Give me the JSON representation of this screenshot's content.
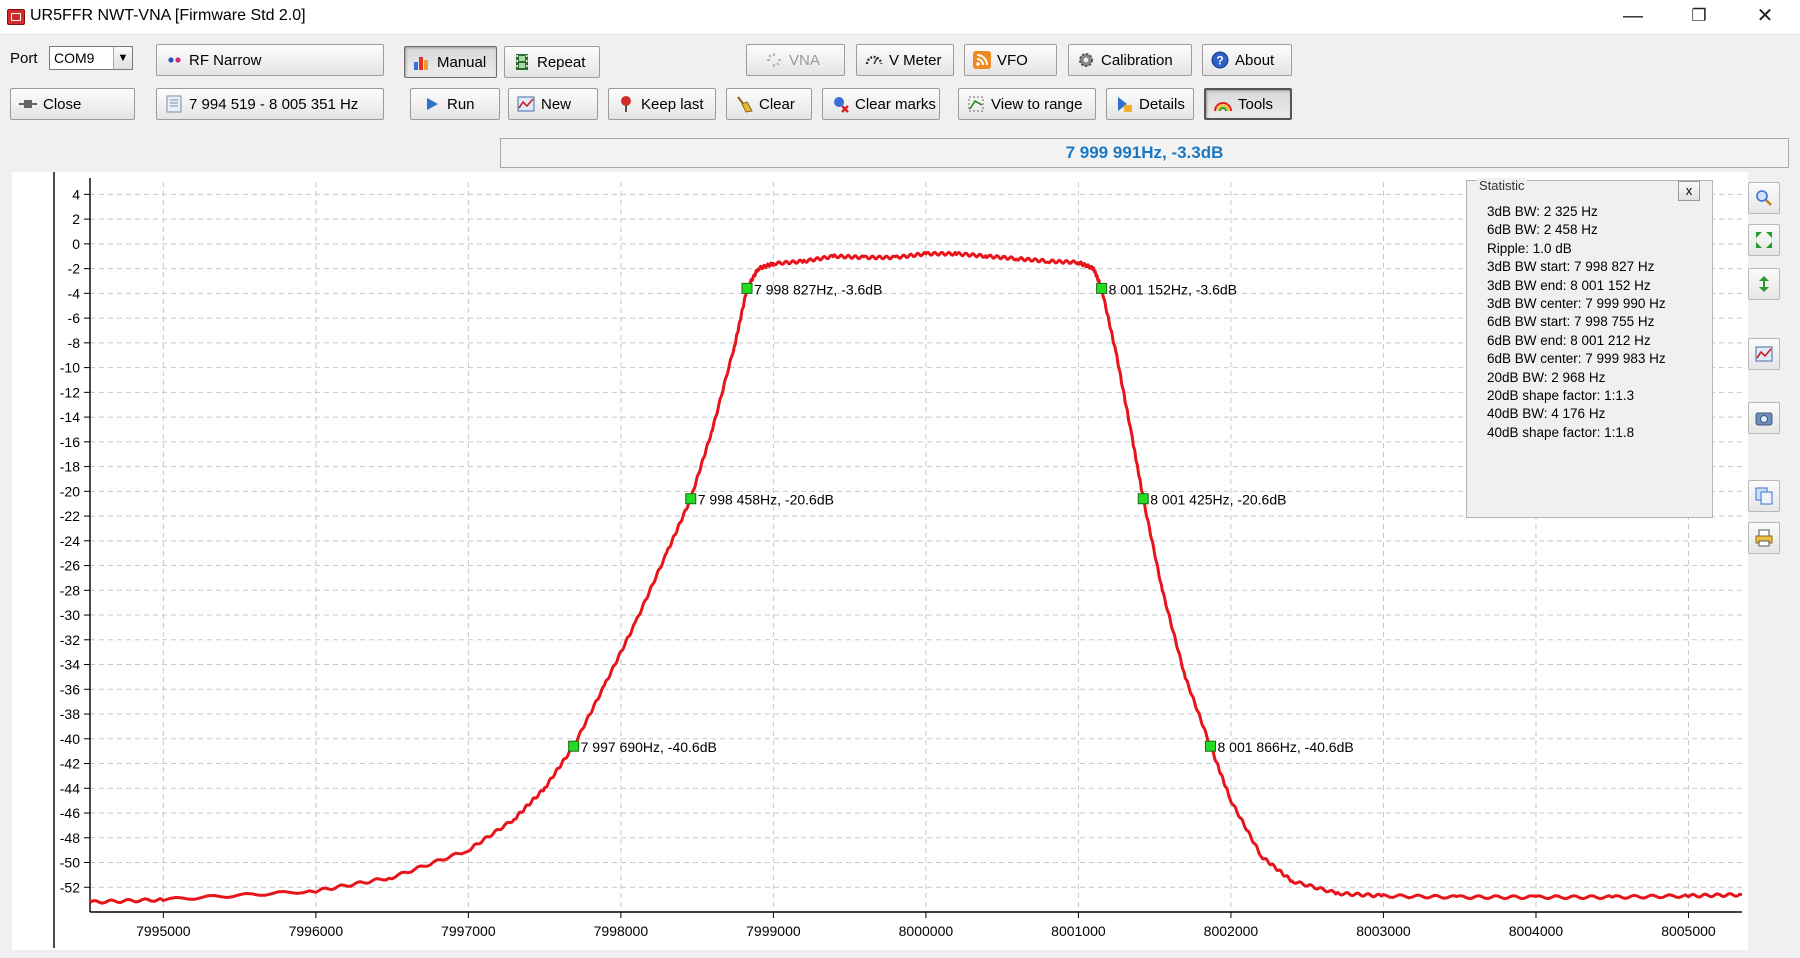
{
  "window": {
    "title": "UR5FFR NWT-VNA [Firmware Std 2.0]",
    "minimize": "—",
    "restore": "❐",
    "close": "✕"
  },
  "toolbar": {
    "port_label": "Port",
    "port_value": "COM9",
    "port_arrow": "▼",
    "rf_narrow": "RF Narrow",
    "close": "Close",
    "freq_range": "7 994 519 - 8 005 351 Hz",
    "manual": "Manual",
    "repeat": "Repeat",
    "run": "Run",
    "new": "New",
    "keep_last": "Keep last",
    "clear": "Clear",
    "clear_marks": "Clear marks",
    "view_to_range": "View to range",
    "details": "Details",
    "tools": "Tools",
    "vna": "VNA",
    "v_meter": "V Meter",
    "vfo": "VFO",
    "calibration": "Calibration",
    "about": "About"
  },
  "cursor_readout": "7 999 991Hz, -3.3dB",
  "statistic": {
    "title": "Statistic",
    "close": "x",
    "lines": [
      "3dB BW: 2 325 Hz",
      "6dB BW: 2 458 Hz",
      "Ripple: 1.0 dB",
      "3dB BW start: 7 998 827 Hz",
      "3dB BW end: 8 001 152 Hz",
      "3dB BW center: 7 999 990 Hz",
      "6dB BW start: 7 998 755 Hz",
      "6dB BW end: 8 001 212 Hz",
      "6dB BW center: 7 999 983 Hz",
      "20dB BW: 2 968 Hz",
      "20dB shape factor: 1:1.3",
      "40dB BW: 4 176 Hz",
      "40dB shape factor: 1:1.8"
    ]
  },
  "side_tools": [
    "zoom-icon",
    "fit-icon",
    "vertical-scale-icon",
    "chart-icon",
    "camera-icon",
    "copy-icon",
    "print-icon"
  ],
  "chart_data": {
    "type": "line",
    "title": "",
    "xlabel": "",
    "ylabel": "",
    "xlim": [
      7994519,
      8005351
    ],
    "ylim": [
      -54,
      5
    ],
    "grid": true,
    "x_ticks": [
      7995000,
      7996000,
      7997000,
      7998000,
      7999000,
      8000000,
      8001000,
      8002000,
      8003000,
      8004000,
      8005000
    ],
    "y_ticks": [
      4,
      2,
      0,
      -2,
      -4,
      -6,
      -8,
      -10,
      -12,
      -14,
      -16,
      -18,
      -20,
      -22,
      -24,
      -26,
      -28,
      -30,
      -32,
      -34,
      -36,
      -38,
      -40,
      -42,
      -44,
      -46,
      -48,
      -50,
      -52
    ],
    "series": [
      {
        "color": "#e8141c",
        "x": [
          7994519,
          7995000,
          7996000,
          7996500,
          7997000,
          7997300,
          7997500,
          7997690,
          7997900,
          7998100,
          7998300,
          7998458,
          7998600,
          7998750,
          7998827,
          7998900,
          7999000,
          7999200,
          7999400,
          7999600,
          7999800,
          8000000,
          8000200,
          8000400,
          8000600,
          8000800,
          8001000,
          8001100,
          8001152,
          8001250,
          8001350,
          8001425,
          8001550,
          8001700,
          8001866,
          8002000,
          8002200,
          8002400,
          8002700,
          8003000,
          8003500,
          8004000,
          8004500,
          8005000,
          8005351
        ],
        "y": [
          -53.2,
          -53.0,
          -52.3,
          -51.2,
          -49.0,
          -46.5,
          -44.0,
          -40.6,
          -35.5,
          -30.5,
          -25.0,
          -20.6,
          -15.0,
          -8.0,
          -3.6,
          -2.0,
          -1.6,
          -1.4,
          -1.0,
          -1.1,
          -1.1,
          -0.8,
          -0.8,
          -1.0,
          -1.2,
          -1.4,
          -1.5,
          -2.0,
          -3.6,
          -9.0,
          -15.5,
          -20.6,
          -28.0,
          -35.0,
          -40.6,
          -45.0,
          -49.5,
          -51.5,
          -52.5,
          -52.7,
          -52.8,
          -52.8,
          -52.8,
          -52.7,
          -52.6
        ]
      }
    ],
    "markers": [
      {
        "x": 7998827,
        "y": -3.6,
        "label": "7 998 827Hz, -3.6dB"
      },
      {
        "x": 8001152,
        "y": -3.6,
        "label": "8 001 152Hz, -3.6dB"
      },
      {
        "x": 7998458,
        "y": -20.6,
        "label": "7 998 458Hz, -20.6dB"
      },
      {
        "x": 8001425,
        "y": -20.6,
        "label": "8 001 425Hz, -20.6dB"
      },
      {
        "x": 7997690,
        "y": -40.6,
        "label": "7 997 690Hz, -40.6dB"
      },
      {
        "x": 8001866,
        "y": -40.6,
        "label": "8 001 866Hz, -40.6dB"
      }
    ],
    "marker_color": "#22dd22"
  }
}
